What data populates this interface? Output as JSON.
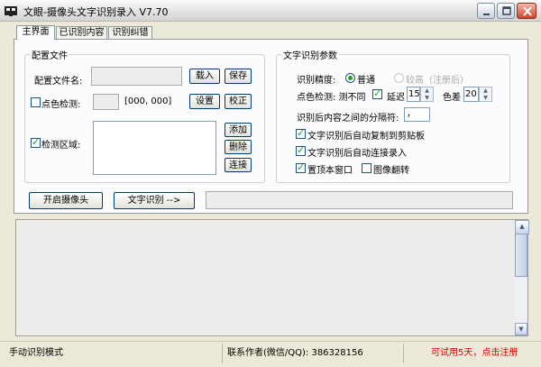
{
  "window": {
    "title": "文眼-摄像头文字识别录入 V7.70"
  },
  "tabs": [
    {
      "label": "主界面"
    },
    {
      "label": "已识别内容"
    },
    {
      "label": "识别纠错"
    }
  ],
  "config_group": {
    "title": "配置文件",
    "config_name_label": "配置文件名:",
    "config_name_value": "",
    "load_button": "载入",
    "save_button": "保存",
    "color_detect_label": "点色检测:",
    "color_detect_checked": false,
    "color_value": "",
    "color_coords": "[000, 000]",
    "set_button": "设置",
    "calibrate_button": "校正",
    "detect_region_label": "检测区域:",
    "detect_region_checked": true,
    "add_button": "添加",
    "delete_button": "删除",
    "connect_button": "连接"
  },
  "ocr_group": {
    "title": "文字识别参数",
    "precision_label": "识别精度:",
    "precision_normal": "普通",
    "precision_high": "较高（注册后）",
    "precision_selected": "普通",
    "color_detect_label": "点色检测: 测不同",
    "measure_different_checked": true,
    "delay_label": "延迟",
    "delay_value": "15",
    "color_diff_label": "色差",
    "color_diff_value": "20",
    "separator_label": "识别后内容之间的分隔符:",
    "separator_value": "，",
    "auto_copy_label": "文字识别后自动复制到剪贴板",
    "auto_copy_checked": true,
    "auto_connect_label": "文字识别后自动连接录入",
    "auto_connect_checked": true,
    "topmost_label": "置顶本窗口",
    "topmost_checked": true,
    "flip_label": "图像翻转",
    "flip_checked": false
  },
  "actions": {
    "open_camera": "开启摄像头",
    "recognize": "文字识别 -->"
  },
  "status": {
    "mode": "手动识别模式",
    "contact": "联系作者(微信/QQ):  386328156",
    "trial": "可试用5天，点击注册",
    "trial_color": "#e00000"
  }
}
